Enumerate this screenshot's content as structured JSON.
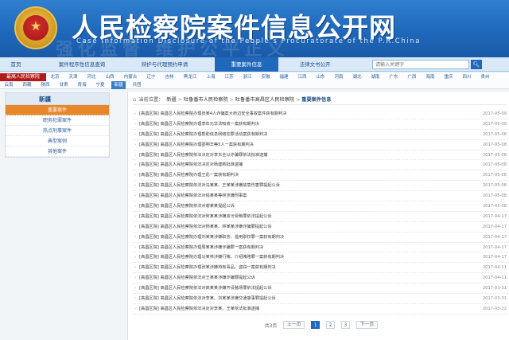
{
  "header": {
    "title": "人民检察院案件信息公开网",
    "subtitle": "Case Information Disclosure of the People's Procuratorate of the P.R.China",
    "watermark": "强化监督 维护公平正义"
  },
  "nav": {
    "items": [
      {
        "label": "首页"
      },
      {
        "label": "案件程序性信息查询"
      },
      {
        "label": "辩护与代理预约申请"
      },
      {
        "label": "重要案件信息"
      },
      {
        "label": "法律文书公开"
      }
    ],
    "active_index": 3,
    "search_placeholder": "请输入关键字"
  },
  "regions": {
    "head": "最高人民检察院",
    "items": [
      "北京",
      "天津",
      "河北",
      "山西",
      "内蒙古",
      "辽宁",
      "吉林",
      "黑龙江",
      "上海",
      "江苏",
      "浙江",
      "安徽",
      "福建",
      "江西",
      "山东",
      "河南",
      "湖北",
      "湖南",
      "广东",
      "广西",
      "海南",
      "重庆",
      "四川",
      "贵州",
      "云南",
      "西藏",
      "陕西",
      "甘肃",
      "青海",
      "宁夏",
      "新疆",
      "兵团"
    ],
    "active": "新疆"
  },
  "sidebar": {
    "title": "新疆",
    "items": [
      "重要案件",
      "职务犯罪案件",
      "热点刑事案件",
      "典型案例",
      "其他案件"
    ],
    "active_index": 0
  },
  "breadcrumb": {
    "label": "当前位置：",
    "parts": [
      "新疆",
      "吐鲁番市人民检察院",
      "吐鲁番市高昌区人民检察院",
      "重要案件信息"
    ]
  },
  "cases": [
    {
      "title": "[高昌区院] 高昌区人民检察院办理张某4人诈骗案大桥边安全事故案件获有期判决",
      "date": "2017-05-09"
    },
    {
      "title": "[高昌区院] 高昌区人民检察院办理李年元非法吸收一案获有期判决",
      "date": "2017-05-09"
    },
    {
      "title": "[高昌区院] 高昌区人民检察院办理帮助信息网络犯罪活动案获有期判决",
      "date": "2017-05-08"
    },
    {
      "title": "[高昌区院] 高昌区人民检察院办理邵明华等5人一案获有期判决",
      "date": "2017-05-08"
    },
    {
      "title": "[高昌区院] 高昌区人民检察院依法决定对李东全以诈骗罪依法批准逮捕",
      "date": "2017-05-08"
    },
    {
      "title": "[高昌区院] 高昌区人民检察院依法决定对杨建新批准逮捕",
      "date": "2017-05-08"
    },
    {
      "title": "[高昌区院] 高昌区人民检察院办理王彪一案获有期判决",
      "date": "2017-05-08"
    },
    {
      "title": "[高昌区院] 高昌区人民检察院依法对冯某某、王某某涉嫌故意伤害罪提起公诉",
      "date": "2017-05-08"
    },
    {
      "title": "[高昌区院] 高昌区人民检察院依法对钱某某等林涉嫌刑事案",
      "date": "2017-05-08"
    },
    {
      "title": "[高昌区院] 高昌区人民检察院依法对谢某某提起公诉",
      "date": "2017-05-08"
    },
    {
      "title": "[高昌区院] 高昌区人民检察院依法对阿某某涉嫌贪污受贿罪依法提起公诉",
      "date": "2017-04-17"
    },
    {
      "title": "[高昌区院] 高昌区人民检察院依法对杨某某、林某某涉嫌诈骗罪提起公诉",
      "date": "2017-04-17"
    },
    {
      "title": "[高昌区院] 高昌区人民检察院办理刘某某涉嫌职务、滥用职权罪一案获有期判决",
      "date": "2017-04-17"
    },
    {
      "title": "[高昌区院] 高昌区人民检察院办理周某某涉嫌诈骗罪一案获有期判决",
      "date": "2017-04-17"
    },
    {
      "title": "[高昌区院] 高昌区人民检察院办理马某林涉嫌行贿、介绍贿赂罪一案获有期判决",
      "date": "2017-04-17"
    },
    {
      "title": "[高昌区院] 高昌区人民检察院办理张某涉嫌持有毒品、盗窃一案获有期判决",
      "date": "2017-04-11"
    },
    {
      "title": "[高昌区院] 高昌区人民检察院依法对王某某涉嫌诈骗罪提起公诉",
      "date": "2017-04-11"
    },
    {
      "title": "[高昌区院] 高昌区人民检察院依法对高某某涉嫌开设赌场罪依法提起公诉",
      "date": "2017-03-31"
    },
    {
      "title": "[高昌区院] 高昌区人民检察院依法对李某、刘某某涉嫌交通肇事罪提起公诉",
      "date": "2017-03-31"
    },
    {
      "title": "[高昌区院] 高昌区人民检察院依法决定对李某、王某依法批准逮捕",
      "date": "2017-03-22"
    }
  ],
  "pager": {
    "total_label": "共3页",
    "prev_label": "上一页",
    "pages": [
      "1",
      "2",
      "3"
    ],
    "current_page": "1",
    "next_label": "下一页"
  }
}
